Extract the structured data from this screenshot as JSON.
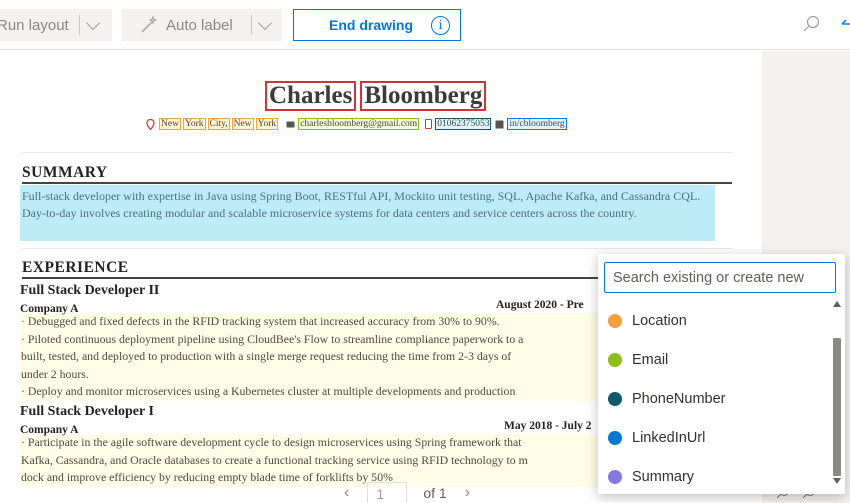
{
  "toolbar": {
    "run_layout_label": "Run layout",
    "auto_label_label": "Auto label",
    "end_drawing_label": "End drawing",
    "info_glyph": "i"
  },
  "document": {
    "name_first": "Charles",
    "name_last": "Bloomberg",
    "location_parts": [
      "New",
      "York",
      "City,",
      "New",
      "York"
    ],
    "email": "charlesbloomberg@gmail.com",
    "phone": "01062375053",
    "linkedin": "in/cbloomberg",
    "summary_heading": "SUMMARY",
    "summary_text": "Full-stack developer with expertise in Java using Spring Boot, RESTful API, Mockito unit testing, SQL, Apache Kafka, and Cassandra CQL. Day-to-day involves creating modular and scalable microservice systems for data centers and service centers across the country.",
    "experience_heading": "EXPERIENCE",
    "jobs": [
      {
        "title": "Full Stack Developer II",
        "company": "Company A",
        "date": "August 2020 - Pre",
        "bullets": [
          "· Debugged and fixed defects in the RFID tracking system that increased accuracy from 30% to 90%.",
          "· Piloted continuous deployment pipeline using CloudBee's Flow to streamline compliance paperwork to a",
          "built, tested, and deployed to production with a single merge request reducing the time from 2-3 days of",
          "under 2 hours.",
          "· Deploy and monitor microservices using a Kubernetes cluster at multiple developments and production"
        ]
      },
      {
        "title": "Full Stack Developer I",
        "company": "Company A",
        "date": "May 2018 - July 2",
        "bullets": [
          "· Participate in the agile software development cycle to design microservices using Spring framework that",
          "Kafka, Cassandra, and Oracle databases to create a functional tracking service using RFID technology to m",
          "dock and improve efficiency by reducing empty blade time of forklifts by 50%"
        ]
      }
    ]
  },
  "pager": {
    "prev": "‹",
    "page": "1",
    "of_label": "of 1",
    "next": "›"
  },
  "popup": {
    "search_placeholder": "Search existing or create new",
    "items": [
      {
        "label": "Location",
        "color": "#f4a03c"
      },
      {
        "label": "Email",
        "color": "#8cbd18"
      },
      {
        "label": "PhoneNumber",
        "color": "#0f5a6b"
      },
      {
        "label": "LinkedInUrl",
        "color": "#0078d4"
      },
      {
        "label": "Summary",
        "color": "#8378de"
      }
    ]
  },
  "colors": {
    "accent": "#0078d4",
    "name_box": "#d13438",
    "summary_highlight": "#bdebf8",
    "experience_highlight": "#fffce8"
  }
}
